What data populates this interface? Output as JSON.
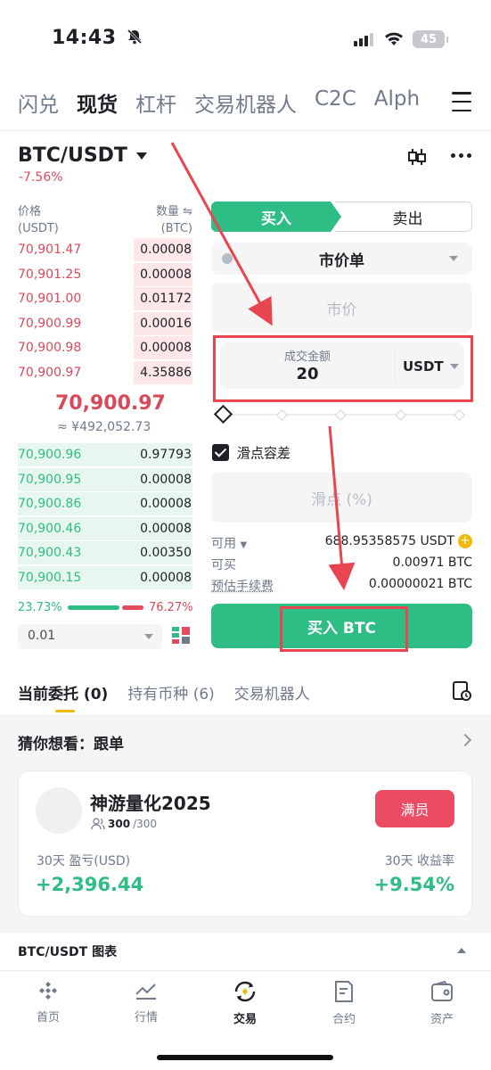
{
  "status_bar": {
    "time": "14:43",
    "battery": "45"
  },
  "top_tabs": [
    "闪兑",
    "现货",
    "杠杆",
    "交易机器人",
    "C2C",
    "Alph"
  ],
  "top_tabs_active": 1,
  "pair": {
    "symbol": "BTC/USDT",
    "change": "-7.56%"
  },
  "order_book": {
    "price_header": "价格",
    "price_unit": "(USDT)",
    "qty_header": "数量 ⇋",
    "qty_unit": "(BTC)",
    "asks": [
      {
        "price": "70,901.47",
        "qty": "0.00008",
        "depth": 0.3
      },
      {
        "price": "70,901.25",
        "qty": "0.00008",
        "depth": 0.3
      },
      {
        "price": "70,901.00",
        "qty": "0.01172",
        "depth": 0.3
      },
      {
        "price": "70,900.99",
        "qty": "0.00016",
        "depth": 0.3
      },
      {
        "price": "70,900.98",
        "qty": "0.00008",
        "depth": 0.3
      },
      {
        "price": "70,900.97",
        "qty": "4.35886",
        "depth": 0.3
      }
    ],
    "mid_price": "70,900.97",
    "mid_cny": "≈ ¥492,052.73",
    "bids": [
      {
        "price": "70,900.96",
        "qty": "0.97793",
        "depth": 0.47
      },
      {
        "price": "70,900.95",
        "qty": "0.00008",
        "depth": 0.47
      },
      {
        "price": "70,900.86",
        "qty": "0.00008",
        "depth": 0.47
      },
      {
        "price": "70,900.46",
        "qty": "0.00008",
        "depth": 0.47
      },
      {
        "price": "70,900.43",
        "qty": "0.00350",
        "depth": 0.47
      },
      {
        "price": "70,900.15",
        "qty": "0.00008",
        "depth": 0.47
      }
    ],
    "buy_ratio": "23.73%",
    "sell_ratio": "76.27%",
    "depth_step": "0.01"
  },
  "trade_form": {
    "buy_tab": "买入",
    "sell_tab": "卖出",
    "order_type": "市价单",
    "market_placeholder": "市价",
    "amount_label": "成交金额",
    "amount_value": "20",
    "amount_unit": "USDT",
    "slippage_label": "滑点容差",
    "slippage_placeholder": "滑点 (%)",
    "available_label": "可用",
    "available_value": "688.95358575 USDT",
    "can_buy_label": "可买",
    "can_buy_value": "0.00971 BTC",
    "fee_label": "预估手续费",
    "fee_value": "0.00000021 BTC",
    "buy_button": "买入 BTC"
  },
  "orders_tabs": [
    "当前委托 (0)",
    "持有币种 (6)",
    "交易机器人"
  ],
  "guess": {
    "title": "猜你想看：跟单",
    "card": {
      "name": "神游量化2025",
      "people_current": "300",
      "people_total": "/300",
      "full_button": "满员",
      "pnl_label": "30天 盈亏(USD)",
      "pnl_value": "+2,396.44",
      "roi_label": "30天 收益率",
      "roi_value": "+9.54%"
    }
  },
  "chart_row": "BTC/USDT 图表",
  "bottom_nav": [
    {
      "label": "首页",
      "icon": "home-icon"
    },
    {
      "label": "行情",
      "icon": "market-icon"
    },
    {
      "label": "交易",
      "icon": "trade-icon"
    },
    {
      "label": "合约",
      "icon": "futures-icon"
    },
    {
      "label": "资产",
      "icon": "wallet-icon"
    }
  ],
  "colors": {
    "green": "#2ebd85",
    "red": "#d84a5a",
    "highlight": "#e84550",
    "yellow": "#f0b90b"
  }
}
